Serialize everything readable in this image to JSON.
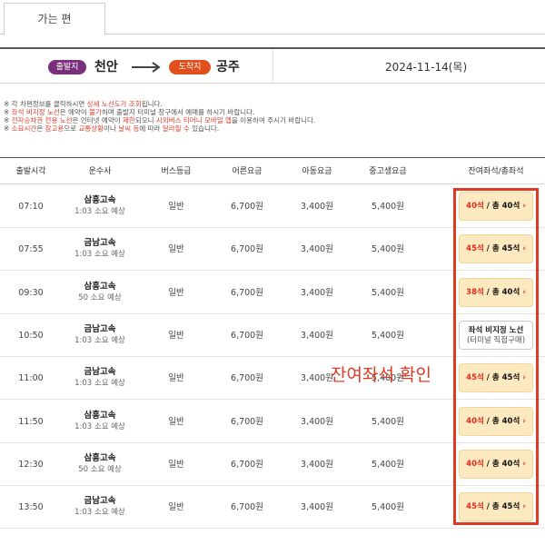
{
  "tabs": {
    "outbound_label": "가는 편"
  },
  "route": {
    "departure_badge": "출발지",
    "departure": "천안",
    "arrival_badge": "도착지",
    "arrival": "공주",
    "date": "2024-11-14(목)"
  },
  "notices": [
    {
      "parts": [
        {
          "t": "※ 각 차편정보를 클릭하시면 ",
          "red": false
        },
        {
          "t": "상세 노선도가 조회",
          "red": true
        },
        {
          "t": "됩니다.",
          "red": false
        }
      ]
    },
    {
      "parts": [
        {
          "t": "※ ",
          "red": false
        },
        {
          "t": "좌석 비지정 노선",
          "red": true
        },
        {
          "t": "은 예약이 ",
          "red": false
        },
        {
          "t": "불가",
          "red": true
        },
        {
          "t": "하며 출발지 터미널 창구에서 예매를 하시기 바랍니다.",
          "red": false
        }
      ]
    },
    {
      "parts": [
        {
          "t": "※ ",
          "red": false
        },
        {
          "t": "전자승차권 전용 노선",
          "red": true
        },
        {
          "t": "은 인터넷 예약이 ",
          "red": false
        },
        {
          "t": "제한",
          "red": true
        },
        {
          "t": "되오니 ",
          "red": false
        },
        {
          "t": "시외버스 티머니 모바일 앱",
          "red": true
        },
        {
          "t": "을 이용하여 주시기 바랍니다.",
          "red": false
        }
      ]
    },
    {
      "parts": [
        {
          "t": "※ ",
          "red": false
        },
        {
          "t": "소요시간",
          "red": true
        },
        {
          "t": "은 ",
          "red": false
        },
        {
          "t": "참고용",
          "red": true
        },
        {
          "t": "으로 ",
          "red": false
        },
        {
          "t": "교통상황",
          "red": true
        },
        {
          "t": "이나 ",
          "red": false
        },
        {
          "t": "날씨 등",
          "red": true
        },
        {
          "t": "에 따라 ",
          "red": false
        },
        {
          "t": "달라질 수",
          "red": true
        },
        {
          "t": " 있습니다.",
          "red": false
        }
      ]
    }
  ],
  "table": {
    "headers": [
      "출발시각",
      "운수사",
      "버스등급",
      "어른요금",
      "아동요금",
      "중고생요금",
      "잔여좌석/총좌석"
    ],
    "rows": [
      {
        "time": "07:10",
        "operator": "삼흥고속",
        "duration": "1:03 소요 예상",
        "grade": "일반",
        "adult": "6,700원",
        "child": "3,400원",
        "youth": "5,400원",
        "avail": "40석",
        "total": "/ 총 40석",
        "reserve": false
      },
      {
        "time": "07:55",
        "operator": "금남고속",
        "duration": "1:03 소요 예상",
        "grade": "일반",
        "adult": "6,700원",
        "child": "3,400원",
        "youth": "5,400원",
        "avail": "45석",
        "total": "/ 총 45석",
        "reserve": false
      },
      {
        "time": "09:30",
        "operator": "삼흥고속",
        "duration": "50 소요 예상",
        "grade": "일반",
        "adult": "6,700원",
        "child": "3,400원",
        "youth": "5,400원",
        "avail": "38석",
        "total": "/ 총 40석",
        "reserve": false
      },
      {
        "time": "10:50",
        "operator": "금남고속",
        "duration": "1:03 소요 예상",
        "grade": "일반",
        "adult": "6,700원",
        "child": "3,400원",
        "youth": "5,400원",
        "reserve": true,
        "reserve_main": "좌석 비지정 노선",
        "reserve_sub": "(터미널 직접구매)"
      },
      {
        "time": "11:00",
        "operator": "금남고속",
        "duration": "1:03 소요 예상",
        "grade": "일반",
        "adult": "6,700원",
        "child": "3,400원",
        "youth": "5,400원",
        "avail": "45석",
        "total": "/ 총 45석",
        "reserve": false
      },
      {
        "time": "11:50",
        "operator": "삼흥고속",
        "duration": "1:03 소요 예상",
        "grade": "일반",
        "adult": "6,700원",
        "child": "3,400원",
        "youth": "5,400원",
        "avail": "40석",
        "total": "/ 총 40석",
        "reserve": false
      },
      {
        "time": "12:30",
        "operator": "삼흥고속",
        "duration": "50 소요 예상",
        "grade": "일반",
        "adult": "6,700원",
        "child": "3,400원",
        "youth": "5,400원",
        "avail": "40석",
        "total": "/ 총 40석",
        "reserve": false
      },
      {
        "time": "13:50",
        "operator": "금남고속",
        "duration": "1:03 소요 예상",
        "grade": "일반",
        "adult": "6,700원",
        "child": "3,400원",
        "youth": "5,400원",
        "avail": "45석",
        "total": "/ 총 45석",
        "reserve": false
      }
    ]
  },
  "annotation": "잔여좌석 확인",
  "colors": {
    "departure_badge": "#7a2f7a",
    "arrival_badge": "#e04f1c",
    "highlight": "#e13a22",
    "seat_button": "#fce9bf"
  },
  "icons": {
    "route_arrow": "arrow-right-icon",
    "seat_chevron": "chevron-right-icon"
  }
}
